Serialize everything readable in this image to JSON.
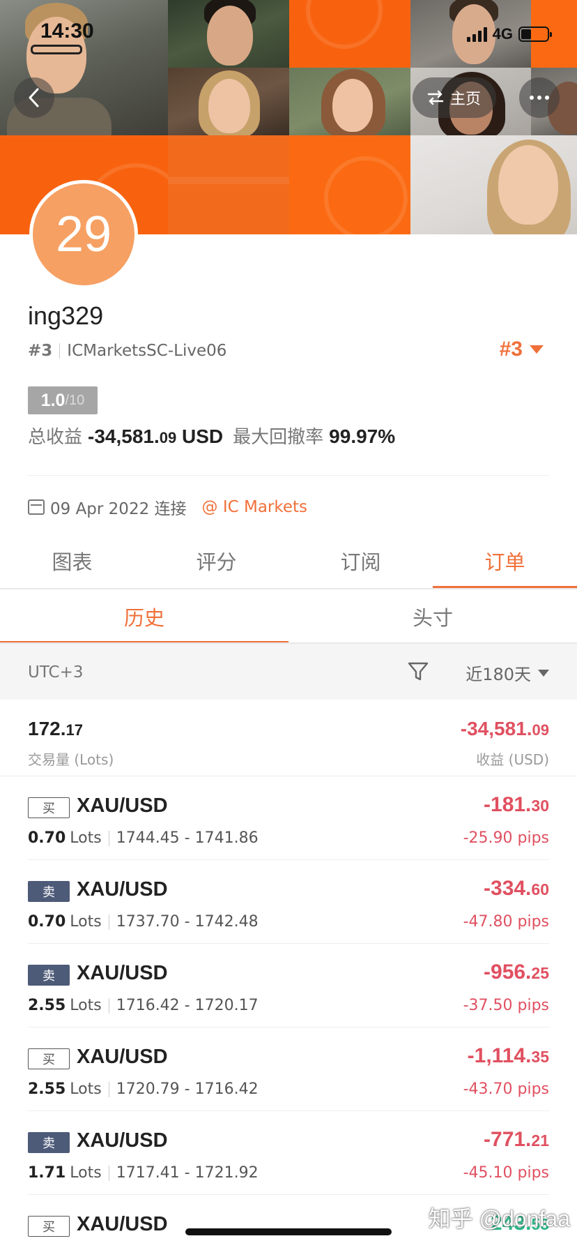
{
  "status_bar": {
    "time": "14:30",
    "network": "4G"
  },
  "header": {
    "home_label": "主页"
  },
  "profile": {
    "avatar_text": "29",
    "username": "ing329",
    "rank_small": "#3",
    "server": "ICMarketsSC-Live06",
    "rank_big": "#3",
    "score_value": "1.0",
    "score_max": "/10",
    "total_profit_label": "总收益",
    "total_profit_main": "-34,581.",
    "total_profit_cents": "09",
    "total_profit_currency": "USD",
    "max_drawdown_label": "最大回撤率",
    "max_drawdown_value": "99.97%",
    "connect_date": "09 Apr 2022 连接",
    "broker": "@ IC Markets"
  },
  "main_tabs": [
    {
      "label": "图表",
      "active": false
    },
    {
      "label": "评分",
      "active": false
    },
    {
      "label": "订阅",
      "active": false
    },
    {
      "label": "订单",
      "active": true
    }
  ],
  "sub_tabs": [
    {
      "label": "历史",
      "active": true
    },
    {
      "label": "头寸",
      "active": false
    }
  ],
  "filter": {
    "timezone": "UTC+3",
    "period": "近180天"
  },
  "summary": {
    "lots_main": "172.",
    "lots_cents": "17",
    "lots_label": "交易量 (Lots)",
    "profit_main": "-34,581.",
    "profit_cents": "09",
    "profit_label": "收益 (USD)"
  },
  "orders": [
    {
      "side": "买",
      "side_type": "buy",
      "symbol": "XAU/USD",
      "lots": "0.70",
      "lots_unit": "Lots",
      "prices": "1744.45 - 1741.86",
      "amount_main": "-181.",
      "amount_cents": "30",
      "pips": "-25.90 pips"
    },
    {
      "side": "卖",
      "side_type": "sell",
      "symbol": "XAU/USD",
      "lots": "0.70",
      "lots_unit": "Lots",
      "prices": "1737.70 - 1742.48",
      "amount_main": "-334.",
      "amount_cents": "60",
      "pips": "-47.80 pips"
    },
    {
      "side": "卖",
      "side_type": "sell",
      "symbol": "XAU/USD",
      "lots": "2.55",
      "lots_unit": "Lots",
      "prices": "1716.42 - 1720.17",
      "amount_main": "-956.",
      "amount_cents": "25",
      "pips": "-37.50 pips"
    },
    {
      "side": "买",
      "side_type": "buy",
      "symbol": "XAU/USD",
      "lots": "2.55",
      "lots_unit": "Lots",
      "prices": "1720.79 - 1716.42",
      "amount_main": "-1,114.",
      "amount_cents": "35",
      "pips": "-43.70 pips"
    },
    {
      "side": "卖",
      "side_type": "sell",
      "symbol": "XAU/USD",
      "lots": "1.71",
      "lots_unit": "Lots",
      "prices": "1717.41 - 1721.92",
      "amount_main": "-771.",
      "amount_cents": "21",
      "pips": "-45.10 pips"
    },
    {
      "side": "买",
      "side_type": "buy",
      "symbol": "XAU/USD",
      "lots": "",
      "lots_unit": "",
      "prices": "",
      "amount_main": "243.",
      "amount_cents": "53",
      "pips": "",
      "positive": true
    }
  ],
  "watermark": "知乎 @donfaa",
  "colors": {
    "accent": "#f0703a",
    "loss": "#e05060",
    "gain": "#2ab886",
    "sell_badge": "#4d5a78",
    "banner_orange": "#f8620f",
    "avatar_bg": "#f6a063"
  }
}
